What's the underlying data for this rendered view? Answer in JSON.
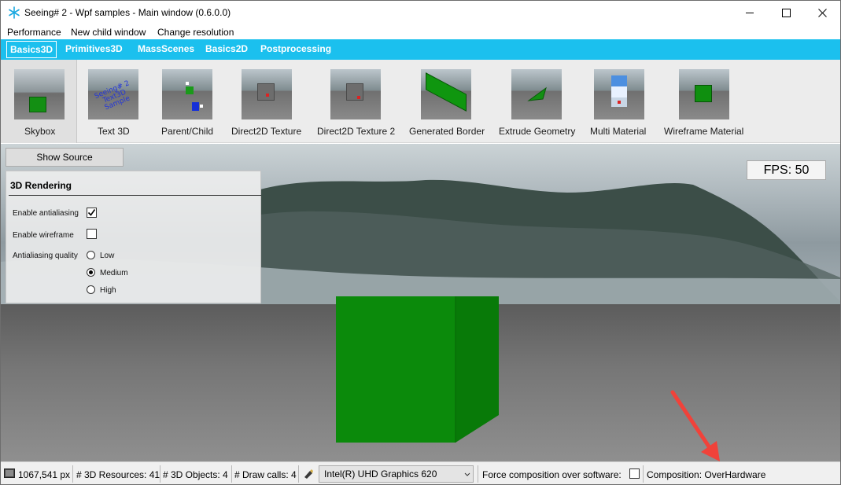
{
  "window": {
    "title": "Seeing# 2 - Wpf samples - Main window (0.6.0.0)"
  },
  "menu": [
    "Performance",
    "New child window",
    "Change resolution"
  ],
  "tabs": [
    {
      "label": "Basics3D",
      "active": true
    },
    {
      "label": "Primitives3D"
    },
    {
      "label": "MassScenes"
    },
    {
      "label": "Basics2D"
    },
    {
      "label": "Postprocessing"
    }
  ],
  "samples": [
    {
      "label": "Skybox",
      "active": true
    },
    {
      "label": "Text 3D",
      "thumb_text": "Seeing# 2 Text3D Sample"
    },
    {
      "label": "Parent/Child"
    },
    {
      "label": "Direct2D Texture"
    },
    {
      "label": "Direct2D Texture 2"
    },
    {
      "label": "Generated Border"
    },
    {
      "label": "Extrude Geometry"
    },
    {
      "label": "Multi Material"
    },
    {
      "label": "Wireframe Material"
    }
  ],
  "viewport": {
    "show_source_label": "Show Source",
    "fps_label": "FPS: 50",
    "settings": {
      "title": "3D Rendering",
      "enable_antialiasing": {
        "label": "Enable antialiasing",
        "checked": true
      },
      "enable_wireframe": {
        "label": "Enable wireframe",
        "checked": false
      },
      "antialiasing_quality": {
        "label": "Antialiasing quality",
        "options": [
          "Low",
          "Medium",
          "High"
        ],
        "selected": "Medium"
      }
    }
  },
  "status": {
    "resolution": "1067,541 px",
    "resources": "# 3D Resources: 41",
    "objects": "# 3D Objects: 4",
    "draw_calls": "# Draw calls: 4",
    "device": "Intel(R) UHD Graphics 620",
    "force_composition_label": "Force composition over software:",
    "force_composition_checked": false,
    "composition": "Composition: OverHardware"
  },
  "colors": {
    "tab_bar": "#1bc0ee",
    "cube_green": "#0b8a0b",
    "annotation_arrow": "#f0423a"
  }
}
